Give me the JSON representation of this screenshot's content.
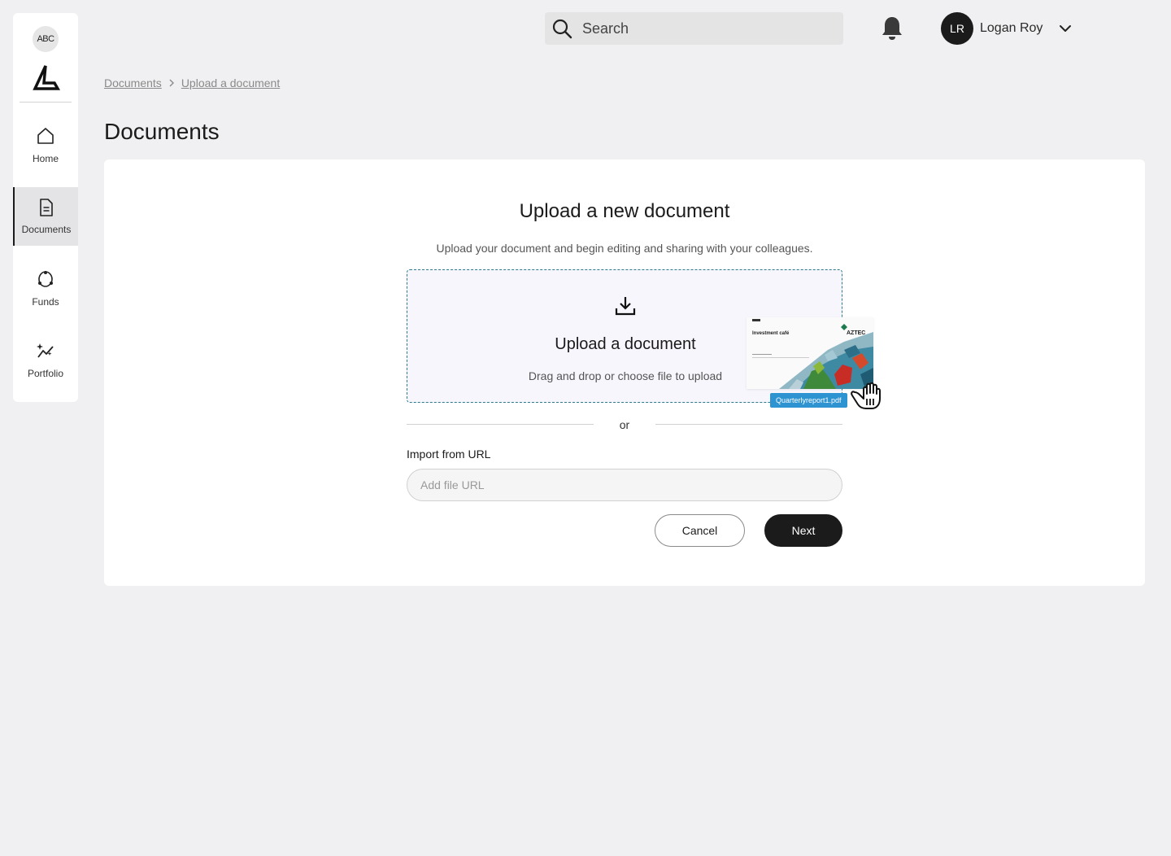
{
  "sidebar": {
    "org_badge": "ABC",
    "logo_icon": "brand-triangle-logo",
    "items": [
      {
        "label": "Home",
        "icon": "home-icon",
        "active": false
      },
      {
        "label": "Documents",
        "icon": "document-icon",
        "active": true
      },
      {
        "label": "Funds",
        "icon": "funds-icon",
        "active": false
      },
      {
        "label": "Portfolio",
        "icon": "portfolio-icon",
        "active": false
      }
    ]
  },
  "topbar": {
    "search_placeholder": "Search",
    "notifications_icon": "bell-icon",
    "user": {
      "initials": "LR",
      "name": "Logan Roy"
    }
  },
  "breadcrumb": [
    "Documents",
    "Upload a document"
  ],
  "page_title": "Documents",
  "upload": {
    "title": "Upload a new document",
    "subtitle": "Upload your document and begin editing and sharing with your colleagues.",
    "dropzone": {
      "title": "Upload a document",
      "subtitle": "Drag and drop or choose file to upload"
    },
    "drag_preview": {
      "doc_title": "Investment café",
      "brand": "AZTEC",
      "file_name": "Quarterlyreport1.pdf"
    },
    "divider_text": "or",
    "url_label": "Import from URL",
    "url_placeholder": "Add file URL",
    "cancel_label": "Cancel",
    "next_label": "Next"
  },
  "colors": {
    "accent_dark": "#1b1b1b",
    "dropzone_border": "#2c7a8c",
    "file_tag": "#2e93d1",
    "background": "#f0f0f2"
  }
}
